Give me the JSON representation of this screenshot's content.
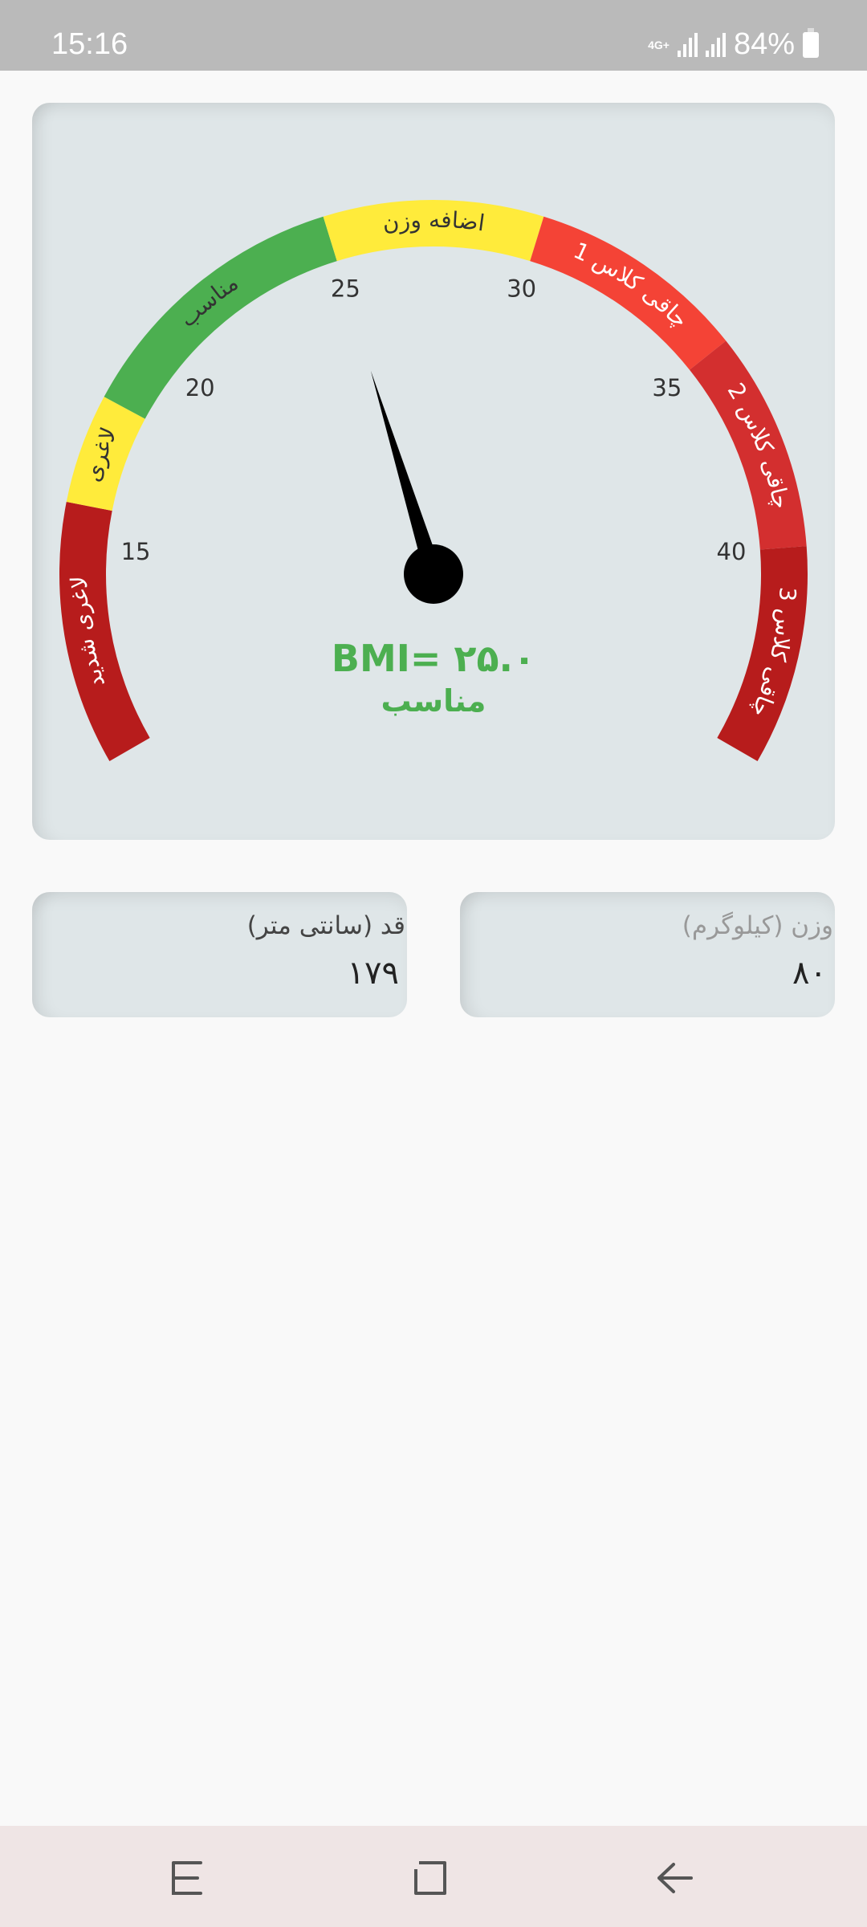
{
  "status_bar": {
    "time": "15:16",
    "network": "4G+",
    "battery": "84%"
  },
  "gauge": {
    "value": 25.0,
    "bmi_label": "BMI= ۲۵.۰",
    "category_label": "مناسب",
    "accent": "#4caf50",
    "range": [
      10,
      45
    ],
    "ticks": [
      "15",
      "20",
      "25",
      "30",
      "35",
      "40"
    ],
    "tick_values": [
      15,
      20,
      25,
      30,
      35,
      40
    ],
    "segments": [
      {
        "from": 10,
        "to": 16,
        "label": "لاغری شدید",
        "color": "#b71c1c",
        "text_color": "#ffffff"
      },
      {
        "from": 16,
        "to": 18.5,
        "label": "لاغری",
        "color": "#ffeb3b",
        "text_color": "#333333"
      },
      {
        "from": 18.5,
        "to": 25,
        "label": "مناسب",
        "color": "#4caf50",
        "text_color": "#333333"
      },
      {
        "from": 25,
        "to": 30,
        "label": "اضافه وزن",
        "color": "#ffeb3b",
        "text_color": "#333333"
      },
      {
        "from": 30,
        "to": 35,
        "label": "چاقی کلاس 1",
        "color": "#f44336",
        "text_color": "#ffffff"
      },
      {
        "from": 35,
        "to": 40,
        "label": "چاقی کلاس 2",
        "color": "#d32f2f",
        "text_color": "#ffffff"
      },
      {
        "from": 40,
        "to": 45,
        "label": "چاقی کلاس 3",
        "color": "#b71c1c",
        "text_color": "#ffffff"
      }
    ]
  },
  "height": {
    "label": "قد (سانتی متر)",
    "value": "۱۷۹"
  },
  "weight": {
    "label": "وزن (کیلوگرم)",
    "value": "۸۰"
  }
}
